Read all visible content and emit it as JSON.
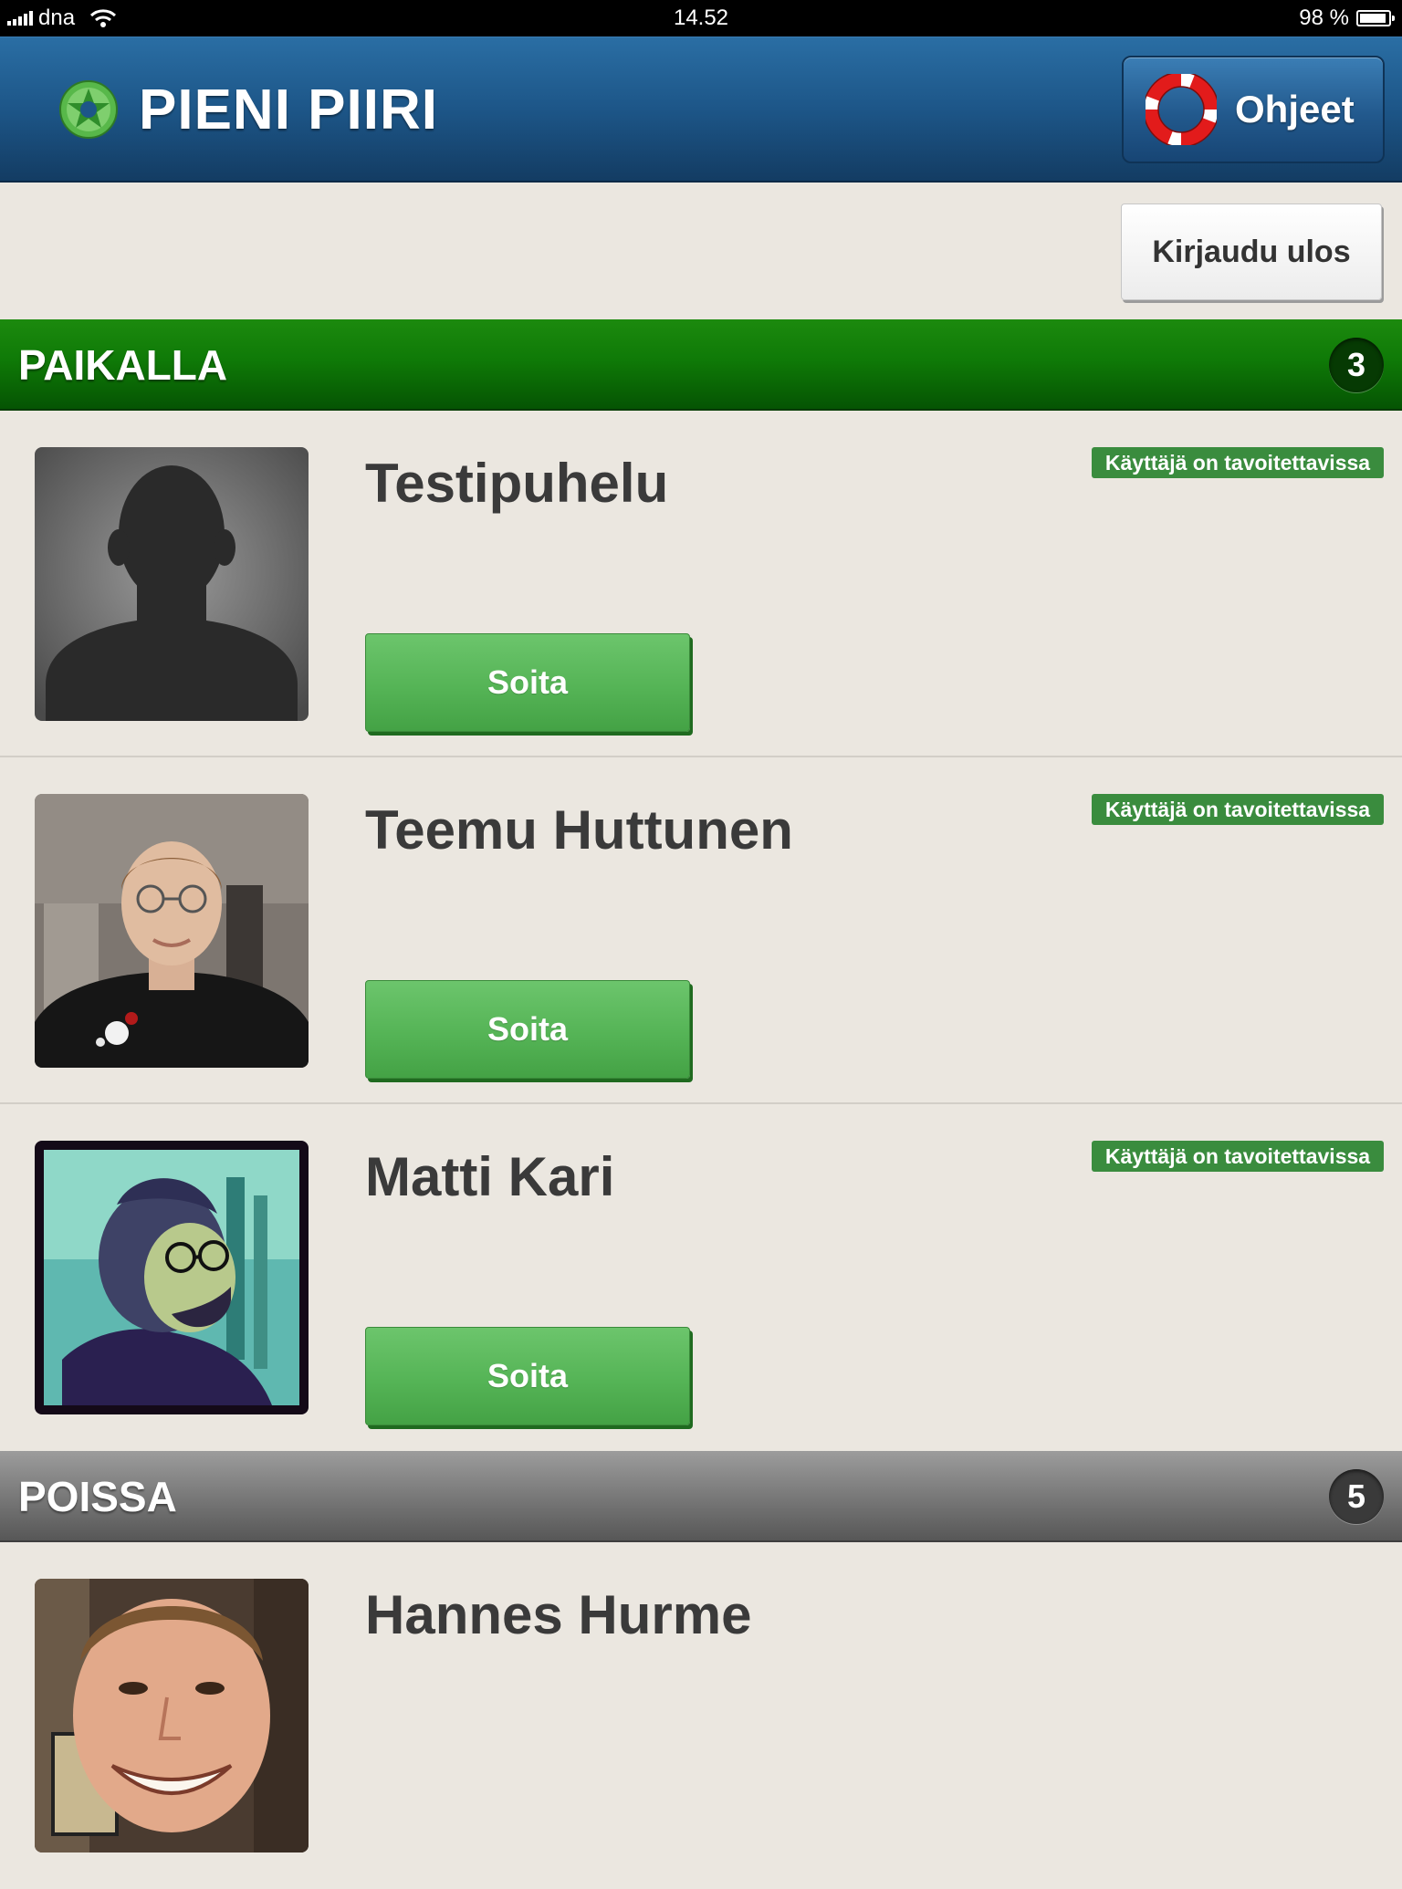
{
  "status_bar": {
    "carrier": "dna",
    "time": "14.52",
    "battery": "98 %"
  },
  "header": {
    "title": "PIENI PIIRI",
    "help_label": "Ohjeet"
  },
  "toolbar": {
    "logout_label": "Kirjaudu ulos"
  },
  "sections": {
    "online": {
      "title": "PAIKALLA",
      "count": "3",
      "contacts": [
        {
          "name": "Testipuhelu",
          "status": "Käyttäjä on tavoitettavissa",
          "call_label": "Soita",
          "avatar_icon": "default-silhouette-avatar"
        },
        {
          "name": "Teemu Huttunen",
          "status": "Käyttäjä on tavoitettavissa",
          "call_label": "Soita",
          "avatar_icon": "profile-photo"
        },
        {
          "name": "Matti Kari",
          "status": "Käyttäjä on tavoitettavissa",
          "call_label": "Soita",
          "avatar_icon": "profile-photo"
        }
      ]
    },
    "offline": {
      "title": "POISSA",
      "count": "5",
      "contacts": [
        {
          "name": "Hannes Hurme",
          "avatar_icon": "profile-photo"
        }
      ]
    }
  },
  "colors": {
    "header_blue": "#1d5688",
    "online_green": "#0f7a07",
    "offline_gray": "#7d7d7d",
    "call_green": "#55b456",
    "badge_green": "#3a8c3e",
    "background": "#ebe7e0"
  }
}
